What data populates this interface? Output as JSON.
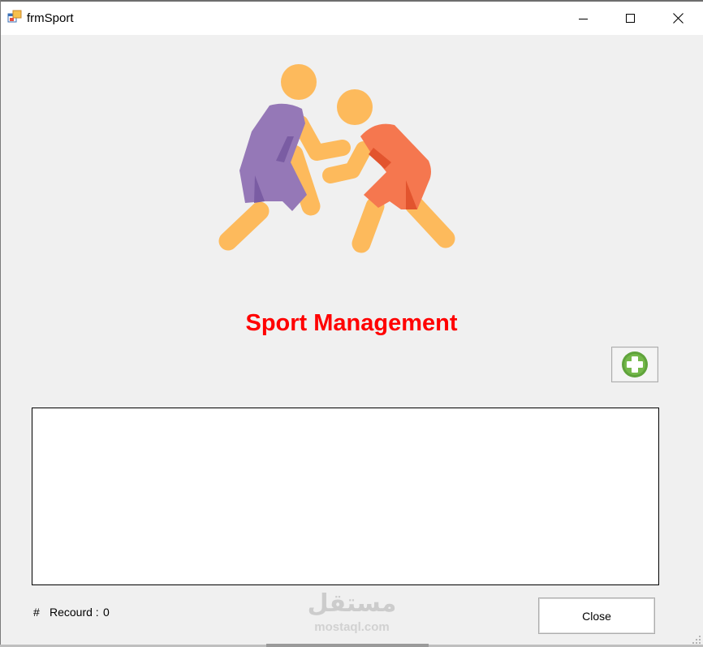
{
  "window": {
    "title": "frmSport",
    "controls": {
      "minimize": "minimize-icon",
      "maximize": "maximize-icon",
      "close": "close-icon"
    }
  },
  "hero": {
    "icon": "wrestlers-illustration"
  },
  "heading": "Sport Management",
  "add_button": {
    "icon": "plus-circle-icon"
  },
  "records": {
    "hash": "#",
    "label": "Recourd :",
    "count": "0"
  },
  "close_button": {
    "label": "Close"
  },
  "watermark": {
    "logo": "مستقل",
    "text": "mostaql.com"
  },
  "colors": {
    "heading": "#ff0000",
    "background": "#f0f0f0",
    "purple": "#9578b7",
    "orange": "#f5774f",
    "skin": "#fdba5c",
    "add_icon": "#5fa33b"
  }
}
